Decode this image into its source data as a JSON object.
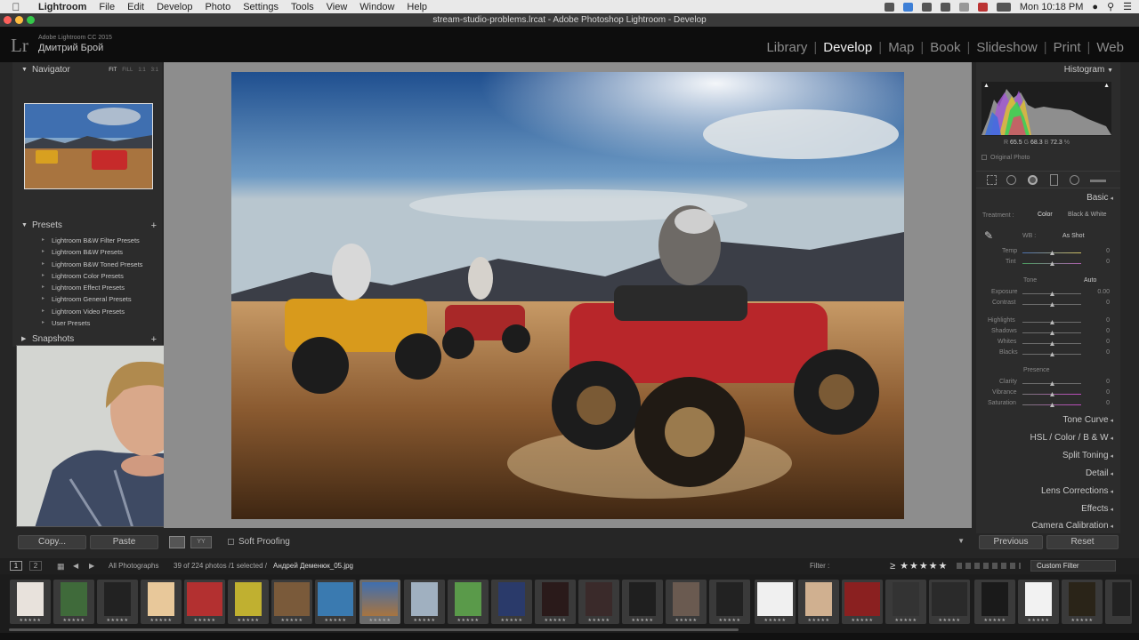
{
  "menubar": {
    "app": "Lightroom",
    "items": [
      "File",
      "Edit",
      "Develop",
      "Photo",
      "Settings",
      "Tools",
      "View",
      "Window",
      "Help"
    ],
    "clock": "Mon 10:18 PM"
  },
  "window": {
    "title": "stream-studio-problems.lrcat - Adobe Photoshop Lightroom - Develop"
  },
  "identity": {
    "logo": "Lr",
    "version": "Adobe Lightroom CC 2015",
    "name": "Дмитрий Брой"
  },
  "modules": [
    "Library",
    "Develop",
    "Map",
    "Book",
    "Slideshow",
    "Print",
    "Web"
  ],
  "active_module": "Develop",
  "left": {
    "navigator": "Navigator",
    "zoom": [
      "FIT",
      "FILL",
      "1:1",
      "3:1"
    ],
    "presets_title": "Presets",
    "presets": [
      "Lightroom B&W Filter Presets",
      "Lightroom B&W Presets",
      "Lightroom B&W Toned Presets",
      "Lightroom Color Presets",
      "Lightroom Effect Presets",
      "Lightroom General Presets",
      "Lightroom Video Presets",
      "User Presets"
    ],
    "snapshots": "Snapshots",
    "copy": "Copy...",
    "paste": "Paste"
  },
  "toolbar": {
    "soft_proofing": "Soft Proofing"
  },
  "right": {
    "histogram": "Histogram",
    "rgb": {
      "r_label": "R",
      "r": "65.5",
      "g_label": "G",
      "g": "68.3",
      "b_label": "B",
      "b": "72.3",
      "unit": "%"
    },
    "original_photo": "Original Photo",
    "basic": "Basic",
    "treatment": "Treatment :",
    "color": "Color",
    "bw": "Black & White",
    "wb": "WB :",
    "wb_value": "As Shot",
    "temp": "Temp",
    "temp_val": "0",
    "tint": "Tint",
    "tint_val": "0",
    "tone": "Tone",
    "auto": "Auto",
    "exposure": "Exposure",
    "exposure_val": "0.00",
    "contrast": "Contrast",
    "contrast_val": "0",
    "highlights": "Highlights",
    "highlights_val": "0",
    "shadows": "Shadows",
    "shadows_val": "0",
    "whites": "Whites",
    "whites_val": "0",
    "blacks": "Blacks",
    "blacks_val": "0",
    "presence": "Presence",
    "clarity": "Clarity",
    "clarity_val": "0",
    "vibrance": "Vibrance",
    "vibrance_val": "0",
    "saturation": "Saturation",
    "saturation_val": "0",
    "sections": [
      "Tone Curve",
      "HSL / Color / B & W",
      "Split Toning",
      "Detail",
      "Lens Corrections",
      "Effects",
      "Camera Calibration"
    ],
    "previous": "Previous",
    "reset": "Reset"
  },
  "filmbar": {
    "pages": [
      "1",
      "2"
    ],
    "source": "All Photographs",
    "count": "39 of 224 photos /1 selected /",
    "file": "Андрей Деменюк_05.jpg",
    "filter_label": "Filter :",
    "custom_filter": "Custom Filter"
  }
}
